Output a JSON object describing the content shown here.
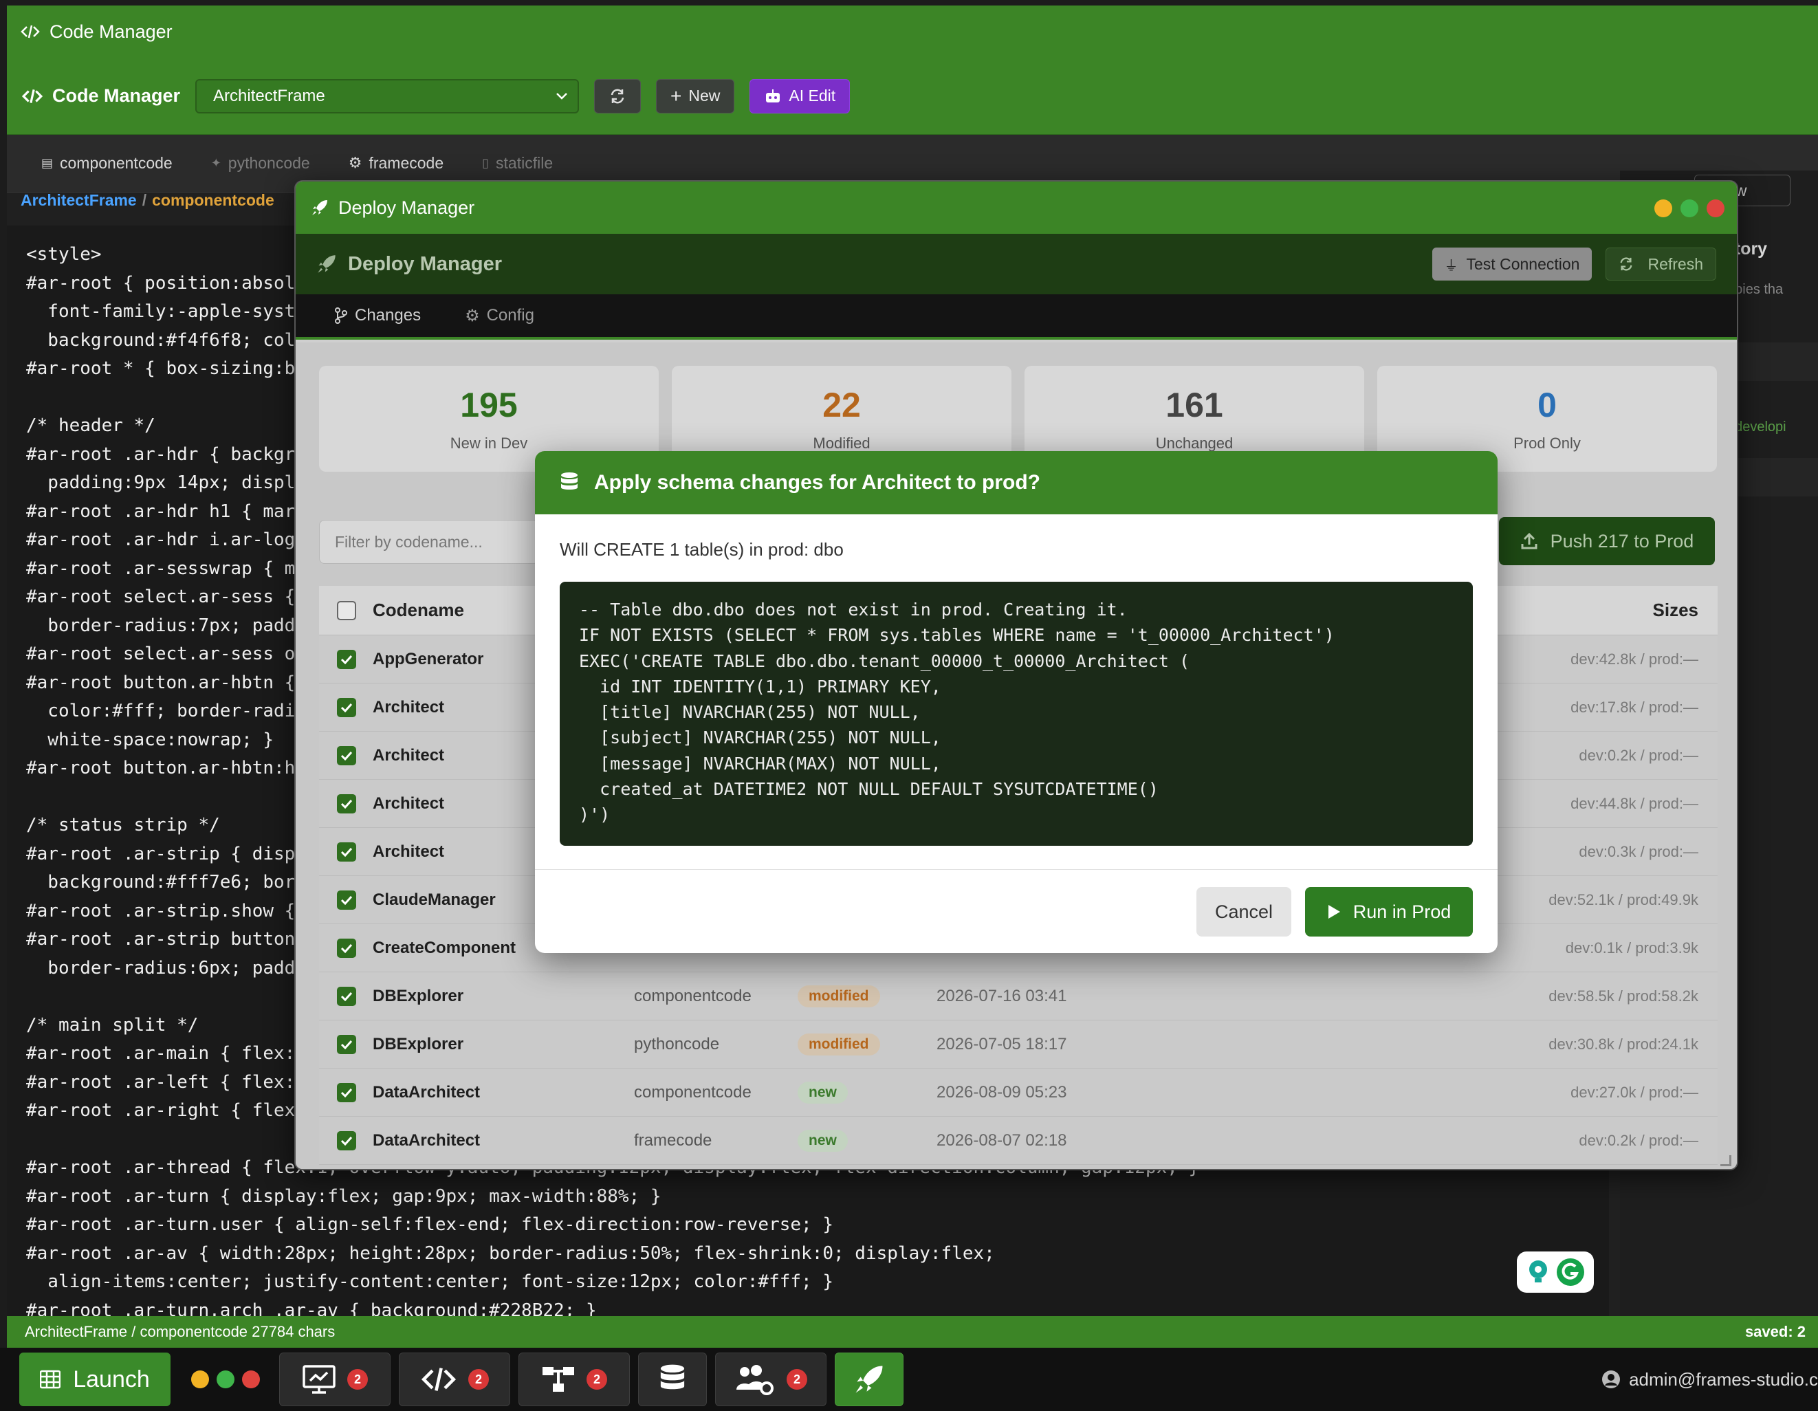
{
  "window": {
    "title": "Code Manager"
  },
  "header": {
    "logo": "Code Manager",
    "selected_frame": "ArchitectFrame",
    "new_label": "New",
    "ai_label": "AI Edit"
  },
  "tabs": [
    "componentcode",
    "pythoncode",
    "framecode",
    "staticfile"
  ],
  "breadcrumb": {
    "frame": "ArchitectFrame",
    "sep": "/",
    "type": "componentcode"
  },
  "editor_lines": [
    "<style>",
    "#ar-root { position:absol",
    "  font-family:-apple-syst",
    "  background:#f4f6f8; col",
    "#ar-root * { box-sizing:b",
    "",
    "/* header */",
    "#ar-root .ar-hdr { backgr",
    "  padding:9px 14px; displ",
    "#ar-root .ar-hdr h1 { mar",
    "#ar-root .ar-hdr i.ar-log",
    "#ar-root .ar-sesswrap { m",
    "#ar-root select.ar-sess {",
    "  border-radius:7px; padd",
    "#ar-root select.ar-sess o",
    "#ar-root button.ar-hbtn {",
    "  color:#fff; border-radi",
    "  white-space:nowrap; }",
    "#ar-root button.ar-hbtn:h",
    "",
    "/* status strip */",
    "#ar-root .ar-strip { disp",
    "  background:#fff7e6; bor",
    "#ar-root .ar-strip.show {",
    "#ar-root .ar-strip button",
    "  border-radius:6px; padd",
    "",
    "/* main split */",
    "#ar-root .ar-main { flex:",
    "#ar-root .ar-left { flex:",
    "#ar-root .ar-right { flex",
    "",
    "#ar-root .ar-thread { flex:1; overflow-y:auto; padding:12px; display:flex; flex-direction:column; gap:12px; }",
    "#ar-root .ar-turn { display:flex; gap:9px; max-width:88%; }",
    "#ar-root .ar-turn.user { align-self:flex-end; flex-direction:row-reverse; }",
    "#ar-root .ar-av { width:28px; height:28px; border-radius:50%; flex-shrink:0; display:flex;",
    "  align-items:center; justify-content:center; font-size:12px; color:#fff; }",
    "#ar-root .ar-turn.arch .ar-av { background:#228B22; }"
  ],
  "right_panel": {
    "view_label": "View",
    "history_label": "istory",
    "copies_text": "copies tha",
    "dev_text": "el developi"
  },
  "statusbar": {
    "left": "ArchitectFrame / componentcode 27784 chars",
    "right": "saved: 2"
  },
  "deploy": {
    "title": "Deploy Manager",
    "header": "Deploy Manager",
    "test_label": "Test Connection",
    "refresh_label": "Refresh",
    "tabs": [
      "Changes",
      "Config"
    ],
    "stats": [
      {
        "value": "195",
        "label": "New in Dev",
        "color": "#2e6e1e"
      },
      {
        "value": "22",
        "label": "Modified",
        "color": "#b5661c"
      },
      {
        "value": "161",
        "label": "Unchanged",
        "color": "#444444"
      },
      {
        "value": "0",
        "label": "Prod Only",
        "color": "#2a6fb5"
      }
    ],
    "filter_placeholder": "Filter by codename...",
    "push_label": "Push 217 to Prod",
    "col_codename": "Codename",
    "col_sizes": "Sizes",
    "rows": [
      {
        "name": "AppGenerator",
        "type": "",
        "status": "",
        "date": "",
        "size": "dev:42.8k / prod:—"
      },
      {
        "name": "Architect",
        "type": "",
        "status": "",
        "date": "",
        "size": "dev:17.8k / prod:—"
      },
      {
        "name": "Architect",
        "type": "",
        "status": "",
        "date": "",
        "size": "dev:0.2k / prod:—"
      },
      {
        "name": "Architect",
        "type": "",
        "status": "",
        "date": "",
        "size": "dev:44.8k / prod:—"
      },
      {
        "name": "Architect",
        "type": "",
        "status": "",
        "date": "",
        "size": "dev:0.3k / prod:—"
      },
      {
        "name": "ClaudeManager",
        "type": "",
        "status": "",
        "date": "",
        "size": "dev:52.1k / prod:49.9k"
      },
      {
        "name": "CreateComponent",
        "type": "",
        "status": "",
        "date": "",
        "size": "dev:0.1k / prod:3.9k"
      },
      {
        "name": "DBExplorer",
        "type": "componentcode",
        "status": "modified",
        "date": "2026-07-16 03:41",
        "size": "dev:58.5k / prod:58.2k"
      },
      {
        "name": "DBExplorer",
        "type": "pythoncode",
        "status": "modified",
        "date": "2026-07-05 18:17",
        "size": "dev:30.8k / prod:24.1k"
      },
      {
        "name": "DataArchitect",
        "type": "componentcode",
        "status": "new",
        "date": "2026-08-09 05:23",
        "size": "dev:27.0k / prod:—"
      },
      {
        "name": "DataArchitect",
        "type": "framecode",
        "status": "new",
        "date": "2026-08-07 02:18",
        "size": "dev:0.2k / prod:—"
      }
    ]
  },
  "confirm": {
    "title": "Apply schema changes for Architect to prod?",
    "text": "Will CREATE 1 table(s) in prod: dbo",
    "sql_lines": [
      "-- Table dbo.dbo does not exist in prod. Creating it.",
      "IF NOT EXISTS (SELECT * FROM sys.tables WHERE name = 't_00000_Architect')",
      "EXEC('CREATE TABLE dbo.dbo.tenant_00000_t_00000_Architect (",
      "  id INT IDENTITY(1,1) PRIMARY KEY,",
      "  [title] NVARCHAR(255) NOT NULL,",
      "  [subject] NVARCHAR(255) NOT NULL,",
      "  [message] NVARCHAR(MAX) NOT NULL,",
      "  created_at DATETIME2 NOT NULL DEFAULT SYSUTCDATETIME()",
      ")')"
    ],
    "cancel_label": "Cancel",
    "run_label": "Run in Prod"
  },
  "taskbar": {
    "launch_label": "Launch",
    "badges": [
      "2",
      "2",
      "2",
      "2"
    ],
    "user": "admin@frames-studio.c"
  },
  "colors": {
    "brand_green": "#3c8526",
    "ai_purple": "#7b2fc9",
    "danger": "#d93737"
  }
}
